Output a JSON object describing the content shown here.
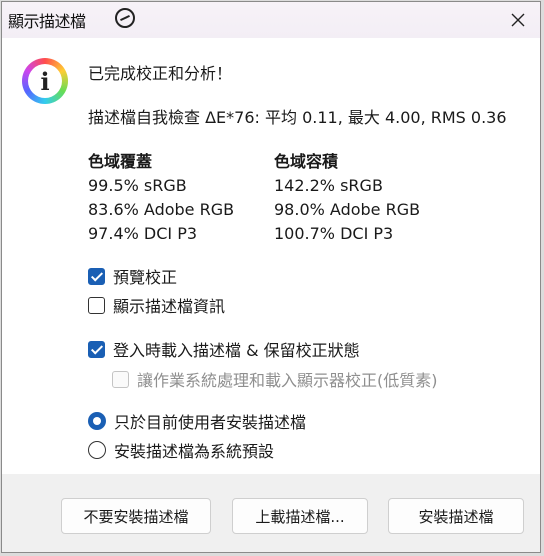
{
  "window": {
    "title": "顯示描述檔"
  },
  "dialog": {
    "headline": "已完成校正和分析！",
    "self_check": "描述檔自我檢查 ΔE*76: 平均 0.11, 最大 4.00, RMS 0.36",
    "gamut_coverage": {
      "header": "色域覆蓋",
      "rows": [
        "99.5% sRGB",
        "83.6% Adobe RGB",
        "97.4% DCI P3"
      ]
    },
    "gamut_volume": {
      "header": "色域容積",
      "rows": [
        "142.2% sRGB",
        "98.0% Adobe RGB",
        "100.7% DCI P3"
      ]
    },
    "options": {
      "preview_calibration": {
        "label": "預覽校正",
        "checked": true
      },
      "show_profile_info": {
        "label": "顯示描述檔資訊",
        "checked": false
      },
      "load_on_login": {
        "label": "登入時載入描述檔 & 保留校正狀態",
        "checked": true
      },
      "os_handles_loading": {
        "label": "讓作業系統處理和載入顯示器校正(低質素)",
        "checked": false,
        "enabled": false
      }
    },
    "install_scope": {
      "current_user": {
        "label": "只於目前使用者安裝描述檔",
        "selected": true
      },
      "system_default": {
        "label": "安裝描述檔為系統預設",
        "selected": false
      }
    }
  },
  "buttons": {
    "dont_install": "不要安裝描述檔",
    "upload": "上載描述檔...",
    "install": "安裝描述檔"
  },
  "colors": {
    "accent": "#1a5fb4",
    "content_bg": "#ffffff",
    "footer_bg": "#f0f0f0"
  }
}
